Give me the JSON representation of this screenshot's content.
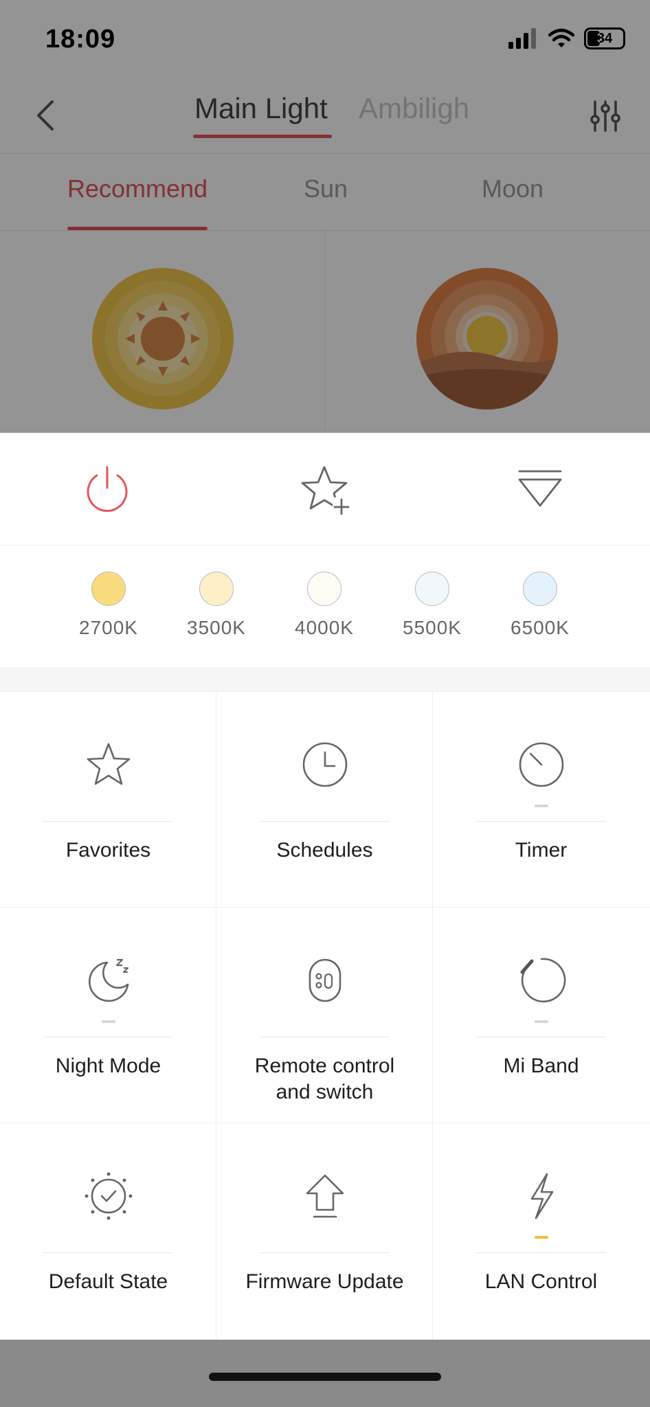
{
  "status": {
    "time": "18:09",
    "battery": "34"
  },
  "nav": {
    "tabs": [
      {
        "label": "Main Light"
      },
      {
        "label": "Ambiligh"
      }
    ]
  },
  "sub_tabs": [
    {
      "label": "Recommend"
    },
    {
      "label": "Sun"
    },
    {
      "label": "Moon"
    }
  ],
  "temperatures": [
    {
      "label": "2700K",
      "color": "#f9dc7e"
    },
    {
      "label": "3500K",
      "color": "#fdf0c8"
    },
    {
      "label": "4000K",
      "color": "#fefcf4"
    },
    {
      "label": "5500K",
      "color": "#f1f8fc"
    },
    {
      "label": "6500K",
      "color": "#e3f2fc"
    }
  ],
  "features": [
    {
      "label": "Favorites",
      "icon": "star-icon"
    },
    {
      "label": "Schedules",
      "icon": "clock-icon"
    },
    {
      "label": "Timer",
      "icon": "timer-icon"
    },
    {
      "label": "Night Mode",
      "icon": "moon-sleep-icon"
    },
    {
      "label": "Remote control and switch",
      "icon": "remote-icon"
    },
    {
      "label": "Mi Band",
      "icon": "band-icon"
    },
    {
      "label": "Default State",
      "icon": "sun-check-icon"
    },
    {
      "label": "Firmware Update",
      "icon": "upload-arrow-icon"
    },
    {
      "label": "LAN Control",
      "icon": "lightning-icon"
    }
  ],
  "colors": {
    "accent": "#e3545c",
    "active_indicator": "#f1c232"
  }
}
